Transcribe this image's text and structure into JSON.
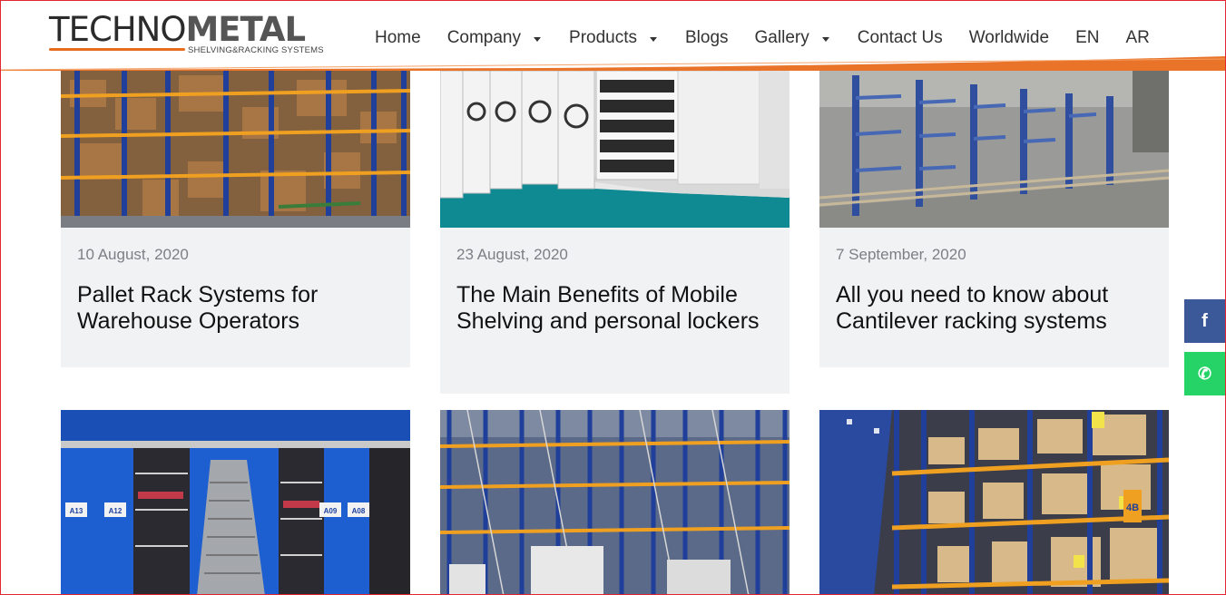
{
  "header": {
    "logo": {
      "word_light": "TECHNO",
      "word_bold": "METAL",
      "tagline": "SHELVING&RACKING SYSTEMS"
    },
    "nav": [
      {
        "label": "Home",
        "has_dropdown": false
      },
      {
        "label": "Company",
        "has_dropdown": true
      },
      {
        "label": "Products",
        "has_dropdown": true
      },
      {
        "label": "Blogs",
        "has_dropdown": false
      },
      {
        "label": "Gallery",
        "has_dropdown": true
      },
      {
        "label": "Contact Us",
        "has_dropdown": false
      },
      {
        "label": "Worldwide",
        "has_dropdown": false
      },
      {
        "label": "EN",
        "has_dropdown": false
      },
      {
        "label": "AR",
        "has_dropdown": false
      }
    ]
  },
  "blog_cards": [
    {
      "date": "10 August, 2020",
      "title": "Pallet Rack Systems for Warehouse Operators",
      "image": "pallet-rack-warehouse-photo"
    },
    {
      "date": "23 August, 2020",
      "title": "The Main Benefits of Mobile Shelving and personal lockers",
      "image": "mobile-shelving-photo"
    },
    {
      "date": "7 September, 2020",
      "title": "All you need to know about Cantilever racking systems",
      "image": "cantilever-racking-photo"
    }
  ],
  "bottom_cards": [
    {
      "image": "mezzanine-shelving-photo",
      "labels": [
        "A13",
        "A12",
        "A09",
        "A08"
      ]
    },
    {
      "image": "drive-in-racking-photo"
    },
    {
      "image": "high-bay-pallet-racking-photo",
      "labels": [
        "4B"
      ]
    }
  ],
  "social": [
    {
      "name": "facebook",
      "glyph": "f",
      "color": "#3b5998"
    },
    {
      "name": "whatsapp",
      "glyph": "✆",
      "color": "#25d366"
    }
  ],
  "colors": {
    "accent": "#e86c1e",
    "card_bg": "#f1f2f4",
    "rack_blue": "#1f3f9a",
    "beam_orange": "#f0a020"
  }
}
